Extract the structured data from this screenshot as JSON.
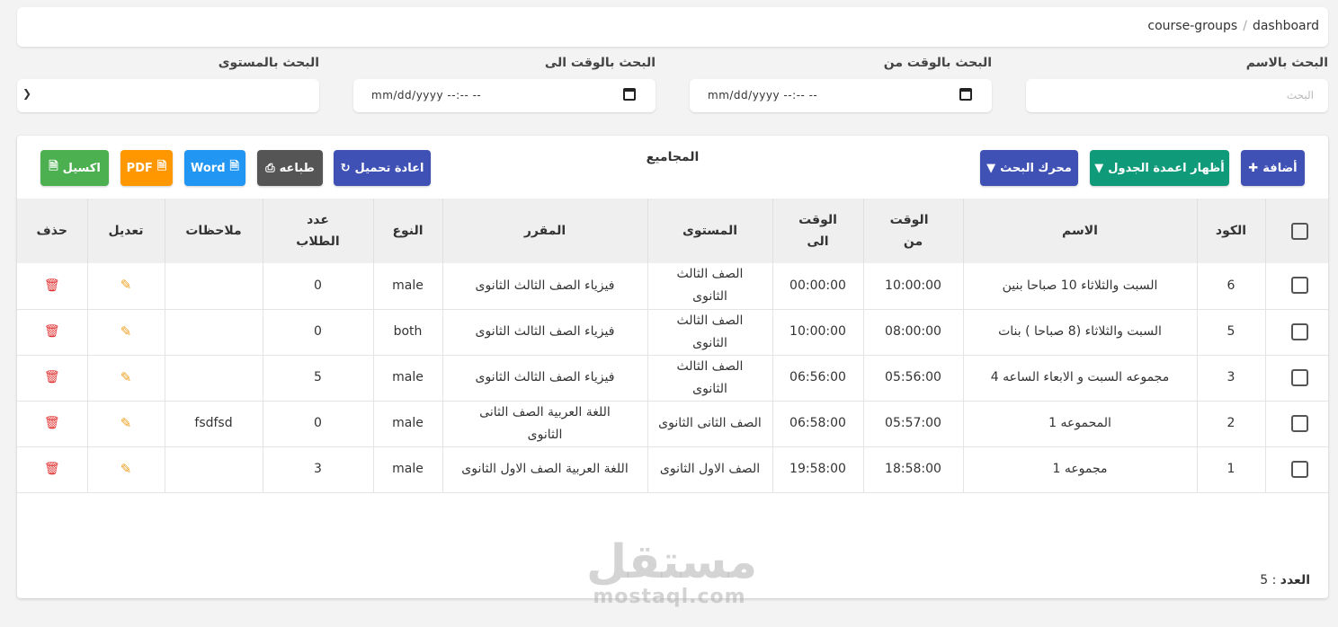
{
  "breadcrumb": {
    "parent": "dashboard",
    "separator": "/",
    "current": "course-groups"
  },
  "filters": {
    "name": {
      "label": "البحث بالاسم",
      "placeholder": "البحث"
    },
    "time_from": {
      "label": "البحث بالوقت من",
      "value": "mm/dd/yyyy --:-- --"
    },
    "time_to": {
      "label": "البحث بالوقت الى",
      "value": "mm/dd/yyyy --:-- --"
    },
    "level": {
      "label": "البحث بالمستوى",
      "value": ""
    }
  },
  "card": {
    "title": "المجاميع",
    "buttons": {
      "add": "أضافة",
      "show_columns": "أظهار اعمدة الجدول",
      "search_engine": "محرك البحث",
      "reload": "اعادة تحميل",
      "print": "طباعه",
      "word": "Word",
      "pdf": "PDF",
      "excel": "اكسيل"
    },
    "colors": {
      "add": "#3f51b5",
      "show_columns": "#0f9a7a",
      "search_engine": "#3f51b5",
      "reload": "#3f51b5",
      "print": "#555555",
      "word": "#2196f3",
      "pdf": "#ff9800",
      "excel": "#4caf50"
    }
  },
  "table": {
    "headers": {
      "code": "الكود",
      "name": "الاسم",
      "time_from": "الوقت من",
      "time_to": "الوقت الى",
      "level": "المستوى",
      "course": "المقرر",
      "type": "النوع",
      "students": "عدد الطلاب",
      "notes": "ملاحظات",
      "edit": "تعديل",
      "delete": "حذف"
    },
    "rows": [
      {
        "code": "6",
        "name": "السبت والثلاثاء 10 صباحا بنين",
        "time_from": "10:00:00",
        "time_to": "00:00:00",
        "level": "الصف الثالث الثانوى",
        "course": "فيزياء الصف الثالث الثانوى",
        "type": "male",
        "students": "0",
        "notes": ""
      },
      {
        "code": "5",
        "name": "السبت والثلاثاء (8 صباحا ) بنات",
        "time_from": "08:00:00",
        "time_to": "10:00:00",
        "level": "الصف الثالث الثانوى",
        "course": "فيزياء الصف الثالث الثانوى",
        "type": "both",
        "students": "0",
        "notes": ""
      },
      {
        "code": "3",
        "name": "مجموعه السبت و الابعاء الساعه 4",
        "time_from": "05:56:00",
        "time_to": "06:56:00",
        "level": "الصف الثالث الثانوى",
        "course": "فيزياء الصف الثالث الثانوى",
        "type": "male",
        "students": "5",
        "notes": ""
      },
      {
        "code": "2",
        "name": "المحموعه 1",
        "time_from": "05:57:00",
        "time_to": "06:58:00",
        "level": "الصف الثانى الثانوى",
        "course": "اللغة العربية الصف الثانى الثانوى",
        "type": "male",
        "students": "0",
        "notes": "fsdfsd"
      },
      {
        "code": "1",
        "name": "مجموعه 1",
        "time_from": "18:58:00",
        "time_to": "19:58:00",
        "level": "الصف الاول الثانوى",
        "course": "اللغة العربية الصف الاول الثانوى",
        "type": "male",
        "students": "3",
        "notes": ""
      }
    ]
  },
  "footer": {
    "count_label": "العدد",
    "count_sep": ":",
    "count_value": "5"
  },
  "watermark": {
    "arabic": "مستقل",
    "latin": "mostaql.com"
  },
  "icons": {
    "edit": "edit-icon",
    "delete": "trash-icon",
    "checkbox": "checkbox-icon",
    "calendar": "calendar-icon",
    "chevron": "chevron-down-icon"
  }
}
